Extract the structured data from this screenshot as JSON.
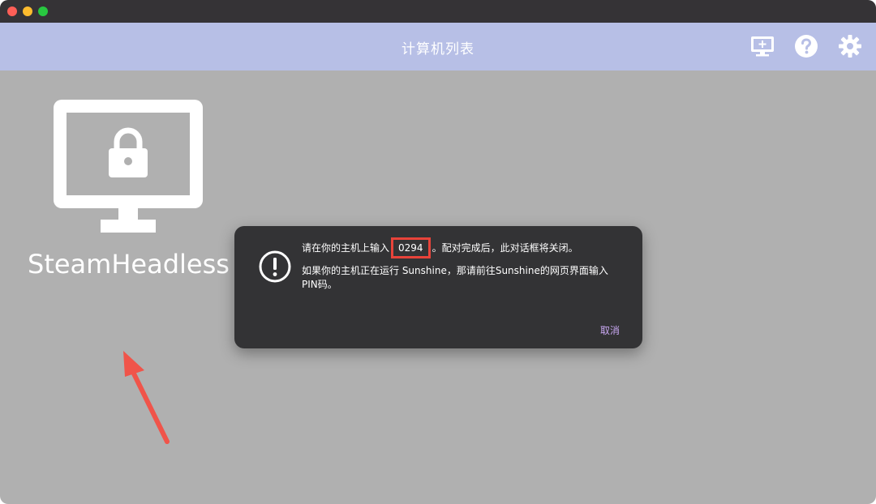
{
  "window": {
    "controls": [
      "close",
      "minimize",
      "zoom"
    ]
  },
  "header": {
    "title": "计算机列表",
    "actions": [
      {
        "icon": "add-computer-icon"
      },
      {
        "icon": "help-icon"
      },
      {
        "icon": "settings-gear-icon"
      }
    ]
  },
  "computers": [
    {
      "name": "SteamHeadless",
      "icon": "locked-monitor-icon"
    }
  ],
  "dialog": {
    "line1_before": "请在你的主机上输入",
    "pin": "0294",
    "line1_after": "。配对完成后，此对话框将关闭。",
    "line2": "如果你的主机正在运行 Sunshine，那请前往Sunshine的网页界面输入PIN码。",
    "cancel_label": "取消",
    "icon": "alert-icon"
  },
  "colors": {
    "header_bg": "#b7bfe6",
    "content_bg": "#b0b0b0",
    "dialog_bg": "#333335",
    "accent_link": "#c9a8f2",
    "highlight": "#e8433a",
    "annotation_arrow": "#f0544a"
  }
}
